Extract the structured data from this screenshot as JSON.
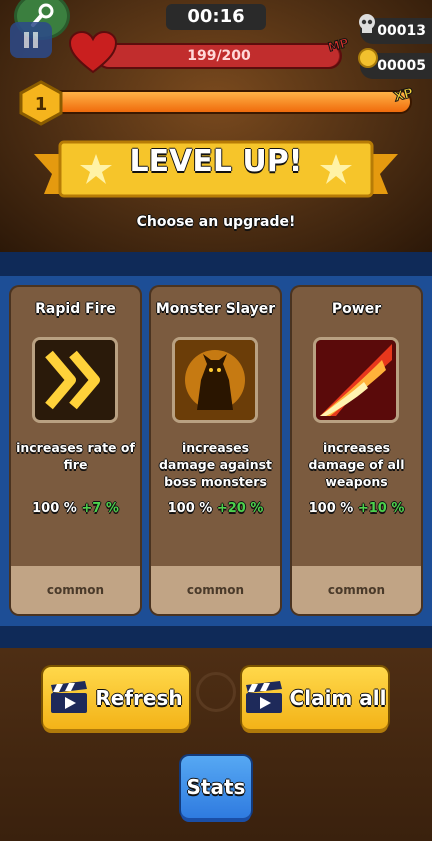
{
  "hud": {
    "timer": "00:16",
    "kills": "00013",
    "coins": "00005",
    "hp_text": "199/200",
    "hp_fraction": 0.995,
    "mp_label": "MP",
    "level": "1",
    "xp_label": "XP",
    "xp_fraction": 1.0
  },
  "banner": {
    "title": "LEVEL UP!",
    "subtitle": "Choose an upgrade!"
  },
  "cards": [
    {
      "title": "Rapid Fire",
      "desc": "increases rate of fire",
      "base": "100 %",
      "bonus": "+7 %",
      "rarity": "common",
      "icon": "double-chevron-icon"
    },
    {
      "title": "Monster Slayer",
      "desc": "increases damage against boss monsters",
      "base": "100 %",
      "bonus": "+20 %",
      "rarity": "common",
      "icon": "demon-icon"
    },
    {
      "title": "Power",
      "desc": "increases damage of all weapons",
      "base": "100 %",
      "bonus": "+10 %",
      "rarity": "common",
      "icon": "fire-slash-icon"
    }
  ],
  "buttons": {
    "refresh": "Refresh",
    "claim_all": "Claim all",
    "stats": "Stats"
  },
  "colors": {
    "hp": "#c12d2d",
    "xp": "#f06b0c",
    "bonus": "#4cd14c",
    "panel": "#1d4e96",
    "button_yellow": "#f3b318",
    "button_blue": "#2f7be0"
  }
}
